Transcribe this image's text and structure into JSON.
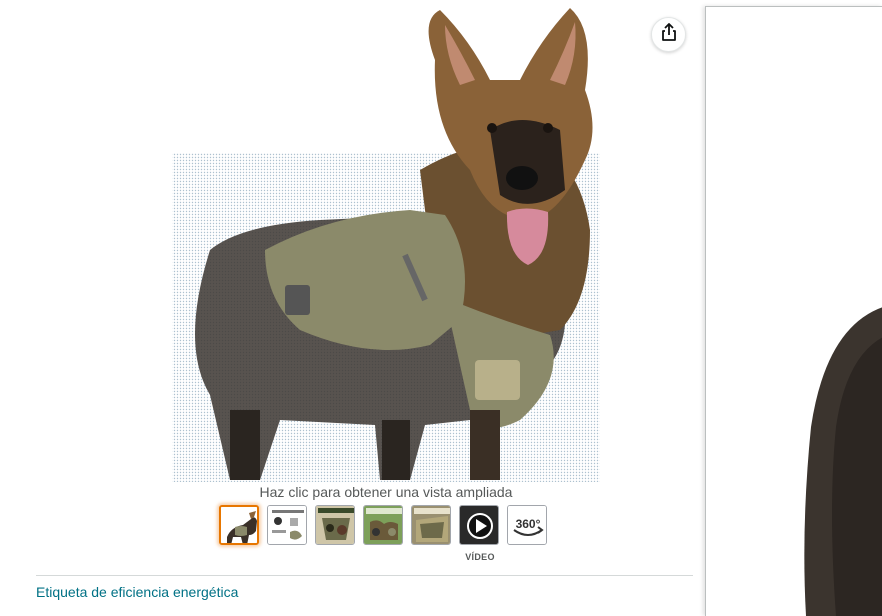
{
  "share": {
    "icon": "share-icon"
  },
  "main_image": {
    "subject": "dog-harness-product-photo"
  },
  "caption": "Haz clic para obtener una vista ampliada",
  "thumbnails": [
    {
      "name": "thumb-dog-harness",
      "selected": true
    },
    {
      "name": "thumb-size-chart"
    },
    {
      "name": "thumb-detail-1"
    },
    {
      "name": "thumb-detail-2"
    },
    {
      "name": "thumb-detail-3"
    },
    {
      "name": "thumb-video",
      "icon": "play-icon"
    },
    {
      "name": "thumb-360",
      "label": "360°"
    }
  ],
  "video_label": "VÍDEO",
  "energy_link": "Etiqueta de eficiencia energética",
  "colors": {
    "link": "#007185",
    "selected_border": "#e77600"
  }
}
